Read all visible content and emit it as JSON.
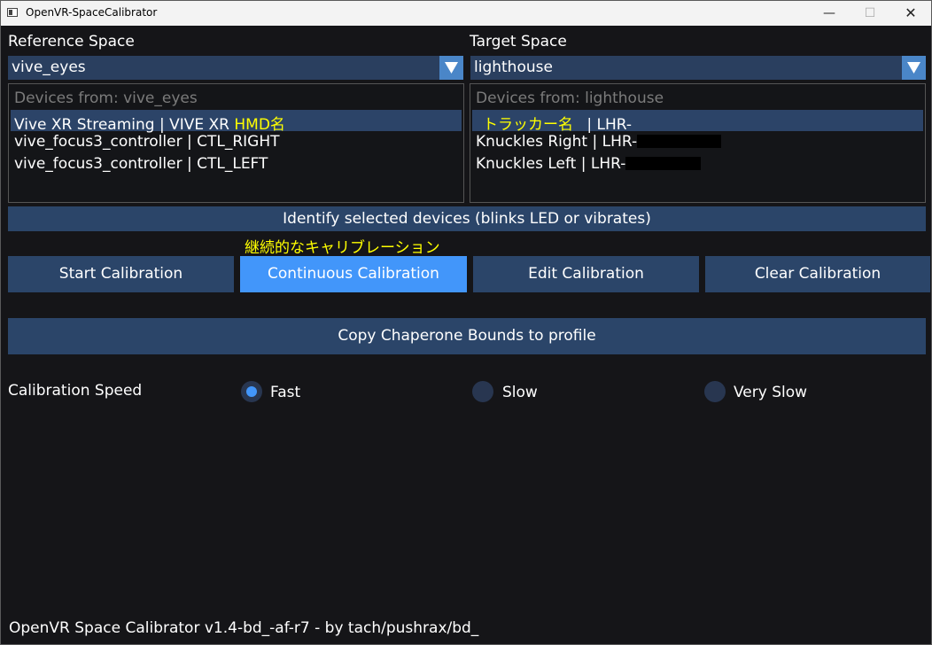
{
  "window": {
    "title": "OpenVR-SpaceCalibrator",
    "minimize": "—",
    "maximize": "☐",
    "close": "✕"
  },
  "reference": {
    "label": "Reference Space",
    "selected": "vive_eyes",
    "list_header": "Devices from: vive_eyes",
    "devices": [
      {
        "text": "Vive XR Streaming | VIVE XR ",
        "note": "HMD名",
        "selected": true
      },
      {
        "text": "vive_focus3_controller | CTL_RIGHT",
        "selected": false
      },
      {
        "text": "vive_focus3_controller | CTL_LEFT",
        "selected": false
      }
    ]
  },
  "target": {
    "label": "Target Space",
    "selected": "lighthouse",
    "list_header": "Devices from: lighthouse",
    "devices": [
      {
        "note": "トラッカー名",
        "text": " | LHR-",
        "selected": true
      },
      {
        "text": "Knuckles Right | LHR-",
        "selected": false,
        "redacted": true
      },
      {
        "text": "Knuckles Left | LHR-",
        "selected": false,
        "redacted": true
      }
    ]
  },
  "identify_button": "Identify selected devices (blinks LED or vibrates)",
  "annotation": "継続的なキャリブレーション",
  "calibration_buttons": {
    "start": "Start Calibration",
    "continuous": "Continuous Calibration",
    "edit": "Edit Calibration",
    "clear": "Clear Calibration"
  },
  "chaperone_button": "Copy Chaperone Bounds to profile",
  "speed": {
    "label": "Calibration Speed",
    "options": [
      "Fast",
      "Slow",
      "Very Slow"
    ],
    "selected": "Fast"
  },
  "footer": "OpenVR Space Calibrator v1.4-bd_-af-r7 - by tach/pushrax/bd_",
  "colors": {
    "accent": "#4296fa",
    "button": "#2b4569",
    "annotation": "#ffff00",
    "background": "#151518"
  }
}
